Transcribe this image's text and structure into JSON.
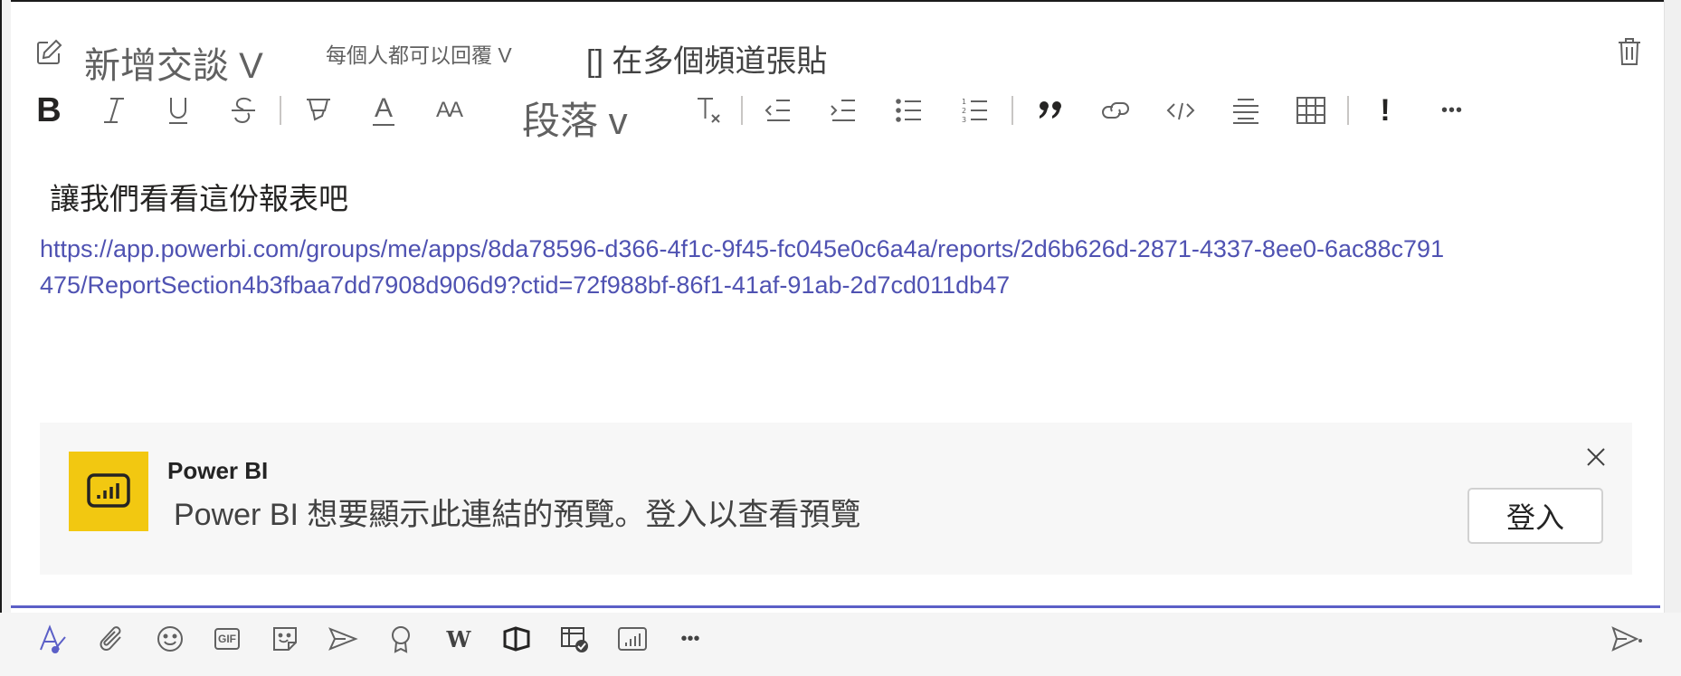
{
  "header": {
    "subject_placeholder": "新增交談 V",
    "reply_option": "每個人都可以回覆 V",
    "post_multiple": "[] 在多個頻道張貼"
  },
  "format_toolbar": {
    "bold": "B",
    "font_color": "A",
    "font_size": "AA",
    "paragraph_style": "段落 v",
    "important": "!",
    "more": "•••"
  },
  "message": {
    "text": "讓我們看看這份報表吧",
    "link": "https://app.powerbi.com/groups/me/apps/8da78596-d366-4f1c-9f45-fc045e0c6a4a/reports/2d6b626d-2871-4337-8ee0-6ac88c791475/ReportSection4b3fbaa7dd7908d906d9?ctid=72f988bf-86f1-41af-91ab-2d7cd011db47"
  },
  "preview_card": {
    "app_name": "Power BI",
    "description": "Power  BI 想要顯示此連結的預覽。登入以查看預覽",
    "sign_in_label": "登入"
  },
  "bottom_toolbar": {
    "gif_label": "GIF",
    "more": "•••"
  },
  "colors": {
    "accent": "#5b5fc7",
    "link": "#4f52b2",
    "powerbi_yellow": "#f2c811",
    "icon_gray": "#616161"
  }
}
